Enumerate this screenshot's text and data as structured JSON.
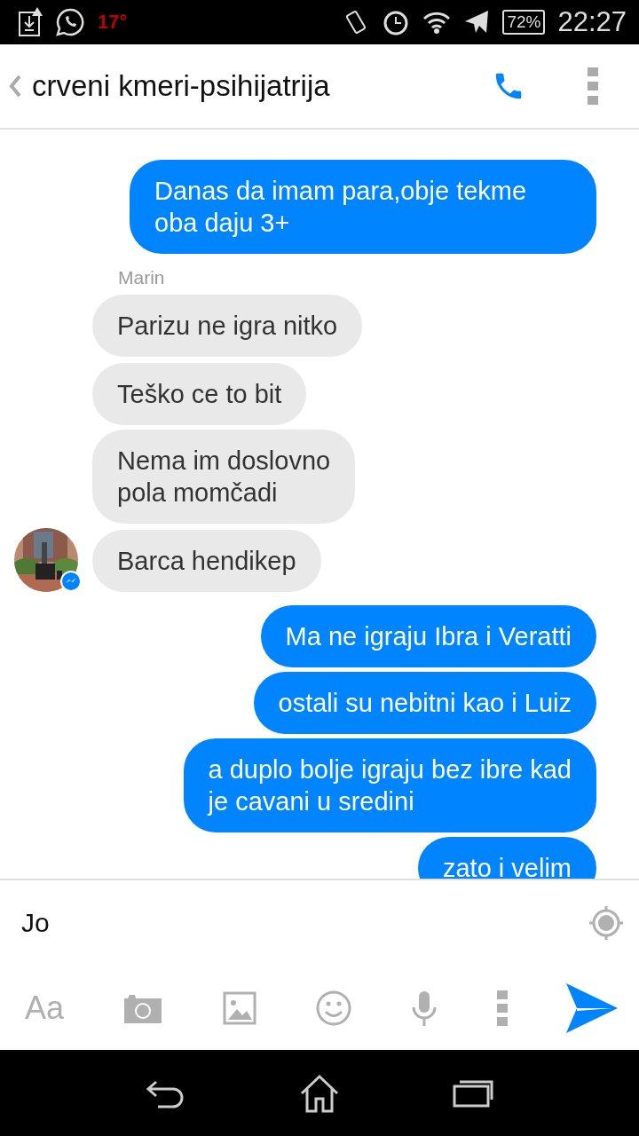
{
  "status_bar": {
    "temperature": "17°",
    "battery": "72%",
    "time": "22:27"
  },
  "header": {
    "title": "crveni kmeri-psihijatrija"
  },
  "messages": [
    {
      "kind": "outgoing",
      "text": "Danas da imam para,obje tekme oba daju 3+"
    },
    {
      "kind": "incoming",
      "sender": "Marin",
      "text": "Parizu ne igra nitko"
    },
    {
      "kind": "incoming",
      "text": "Teško ce to bit"
    },
    {
      "kind": "incoming",
      "text": "Nema im doslovno\npola momčadi"
    },
    {
      "kind": "incoming",
      "text": "Barca hendikep",
      "avatar": true
    },
    {
      "kind": "outgoing",
      "text": "Ma ne igraju Ibra i Veratti"
    },
    {
      "kind": "outgoing",
      "text": "ostali su nebitni kao i Luiz"
    },
    {
      "kind": "outgoing",
      "text": "a duplo bolje igraju bez ibre kad\nje cavani u sredini"
    },
    {
      "kind": "outgoing",
      "text": "zato i velim"
    }
  ],
  "composer": {
    "value": "Jo",
    "text_style_label": "Aa"
  }
}
